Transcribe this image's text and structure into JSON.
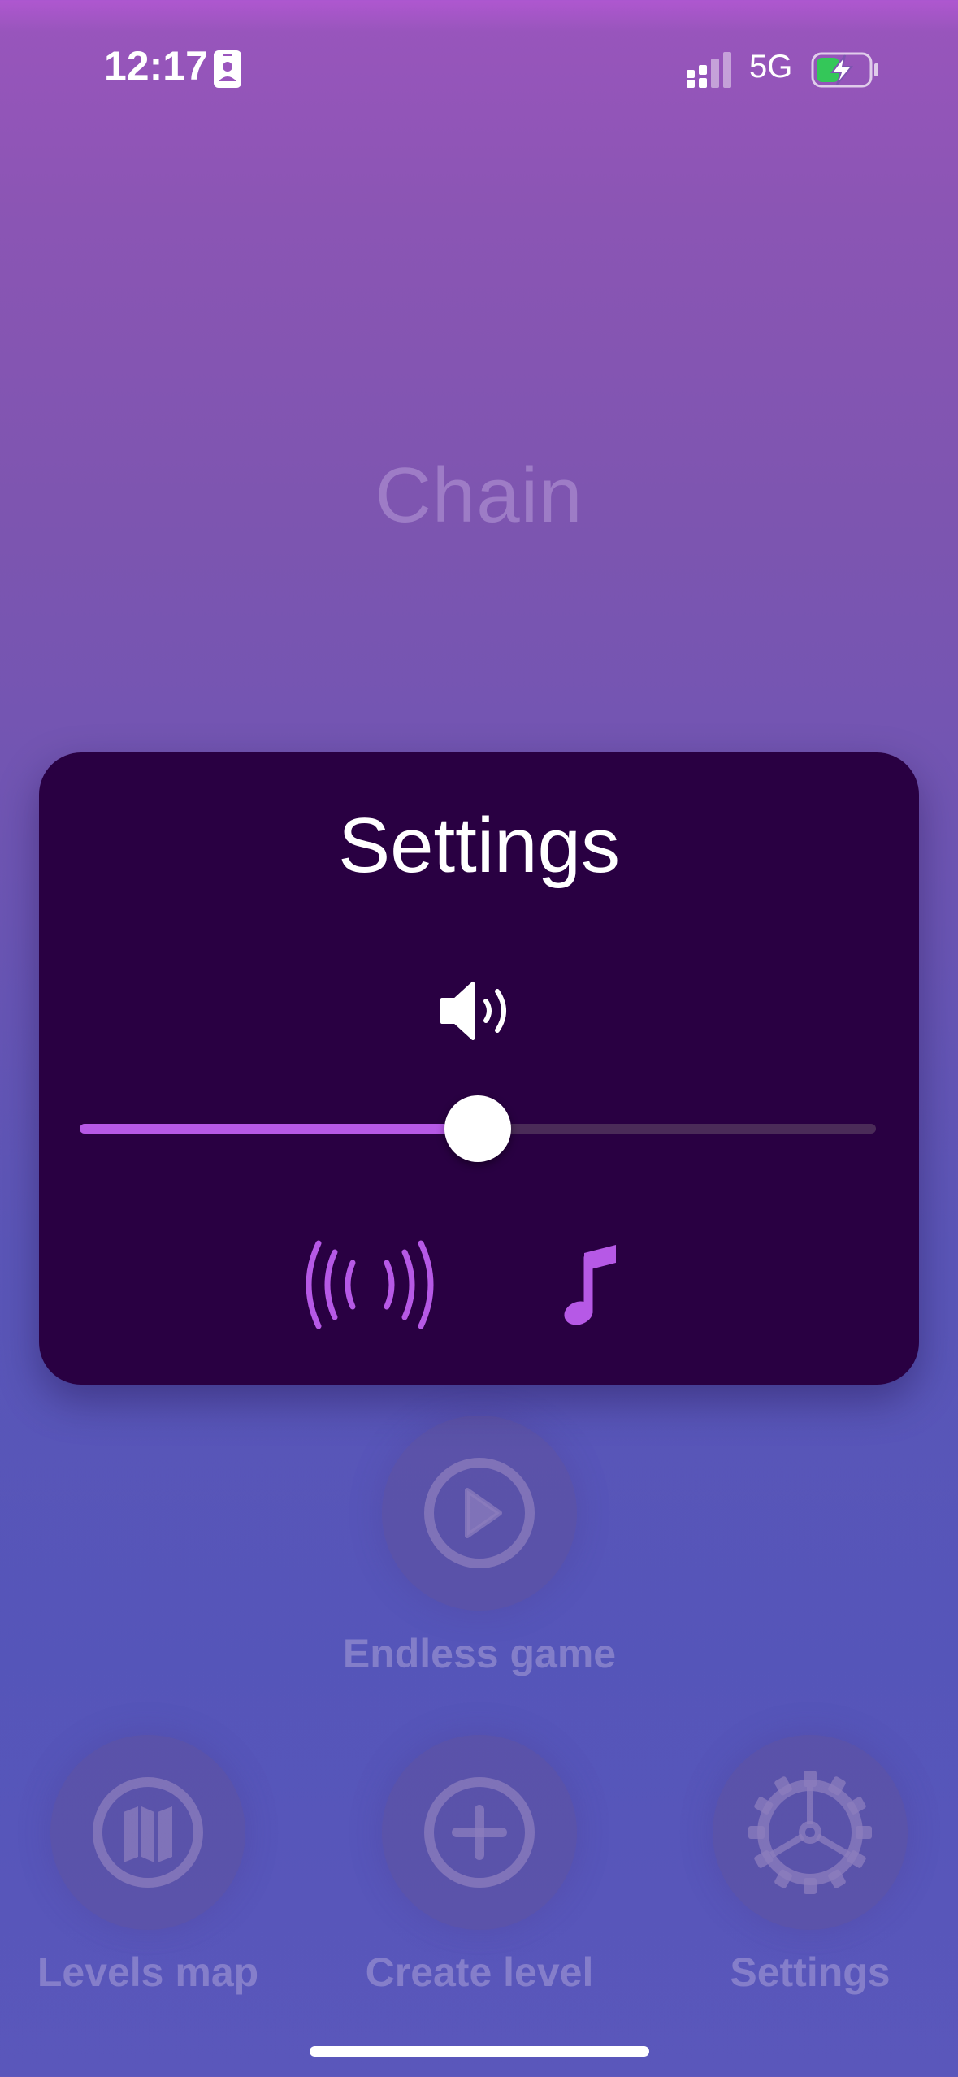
{
  "status_bar": {
    "time": "12:17",
    "network": "5G",
    "icons": [
      "contact-card-icon",
      "signal-icon",
      "battery-charging-icon"
    ],
    "battery_color": "#34c759"
  },
  "background": {
    "title": "Chain",
    "buttons": [
      {
        "label": "Endless game",
        "icon": "play-icon"
      },
      {
        "label": "Levels map",
        "icon": "map-icon"
      },
      {
        "label": "Create level",
        "icon": "plus-icon"
      },
      {
        "label": "Settings",
        "icon": "gear-icon"
      }
    ]
  },
  "settings_panel": {
    "title": "Settings",
    "volume_icon": "speaker-icon",
    "volume_level": 0.5,
    "vibration_icon": "vibration-icon",
    "music_icon": "music-note-icon",
    "accent_color": "#b659e6",
    "panel_color": "#290042"
  }
}
